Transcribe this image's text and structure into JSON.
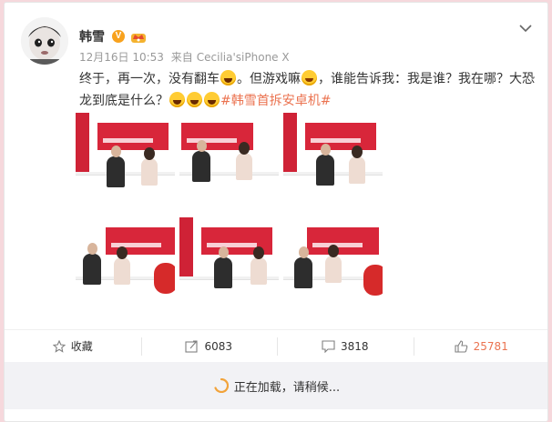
{
  "post": {
    "author": "韩雪",
    "verified_badge": "V",
    "time": "12月16日 10:53",
    "source_prefix": "来自",
    "source": "Cecilia'siPhone X",
    "text": {
      "part1": "终于，再一次，没有翻车",
      "part2": "。但游戏嘛",
      "part3": "，谁能告诉我：我是谁？我在哪？大恐龙到底是什么？",
      "hashtag": "#韩雪首拆安卓机#"
    },
    "photo_banner_text": "科技女神-韩雪",
    "photo_banner_sub": "首拆安卓机"
  },
  "actions": {
    "favorite": "收藏",
    "repost": "6083",
    "comment": "3818",
    "like": "25781"
  },
  "loading_text": "正在加载，请稍候...",
  "colors": {
    "accent": "#eb7350",
    "page_bg": "#f6d8dc",
    "verified": "#f8a21e",
    "banner_red": "#d8263a"
  },
  "icons": [
    "chevron-down-icon",
    "star-icon",
    "share-icon",
    "comment-icon",
    "thumb-up-icon",
    "spinner-icon",
    "verified-icon",
    "crown-icon"
  ]
}
